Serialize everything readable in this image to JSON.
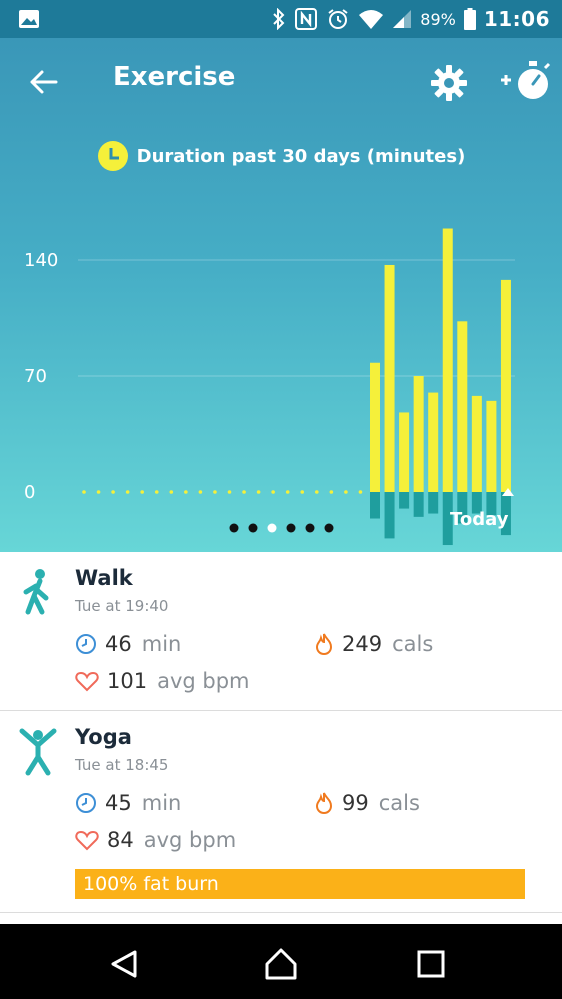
{
  "status_bar": {
    "battery": "89%",
    "time": "11:06",
    "icons": [
      "image-icon",
      "bluetooth-icon",
      "nfc-icon",
      "alarm-icon",
      "wifi-icon",
      "signal-icon",
      "battery-icon"
    ]
  },
  "header": {
    "title": "Exercise",
    "back_icon": "back-arrow-icon",
    "settings_icon": "gear-icon",
    "add_icon": "add-stopwatch-icon"
  },
  "legend": {
    "label": "Duration past 30 days (minutes)",
    "icon": "clock-icon",
    "color": "#f5f03a"
  },
  "chart_data": {
    "type": "bar",
    "y_ticks": [
      "140",
      "70",
      "0"
    ],
    "ylim": [
      0,
      140
    ],
    "x_label_last": "Today",
    "days": 30,
    "values": [
      0,
      0,
      0,
      0,
      0,
      0,
      0,
      0,
      0,
      0,
      0,
      0,
      0,
      0,
      0,
      0,
      0,
      0,
      0,
      0,
      78,
      137,
      48,
      70,
      60,
      159,
      103,
      58,
      55,
      128
    ],
    "below_values": [
      0,
      0,
      0,
      0,
      0,
      0,
      0,
      0,
      0,
      0,
      0,
      0,
      0,
      0,
      0,
      0,
      0,
      0,
      0,
      0,
      16,
      28,
      10,
      15,
      13,
      32,
      19,
      13,
      14,
      26
    ],
    "bar_color": "#f5f03a",
    "below_color": "#1f9e9e",
    "page_dots": 6,
    "active_dot": 2
  },
  "activities": [
    {
      "name": "Walk",
      "when": "Tue at 19:40",
      "icon": "walk-icon",
      "duration_value": "46",
      "duration_unit": "min",
      "cals_value": "249",
      "cals_unit": "cals",
      "bpm_value": "101",
      "bpm_unit": "avg bpm"
    },
    {
      "name": "Yoga",
      "when": "Tue at 18:45",
      "icon": "yoga-icon",
      "duration_value": "45",
      "duration_unit": "min",
      "cals_value": "99",
      "cals_unit": "cals",
      "bpm_value": "84",
      "bpm_unit": "avg bpm",
      "badge": "100% fat burn"
    }
  ],
  "colors": {
    "accent_teal": "#3a97b8",
    "fat_burn": "#fbb118",
    "clock_blue": "#3d8fd6",
    "flame_orange": "#f07a1f",
    "heart_red": "#f06a5a"
  }
}
